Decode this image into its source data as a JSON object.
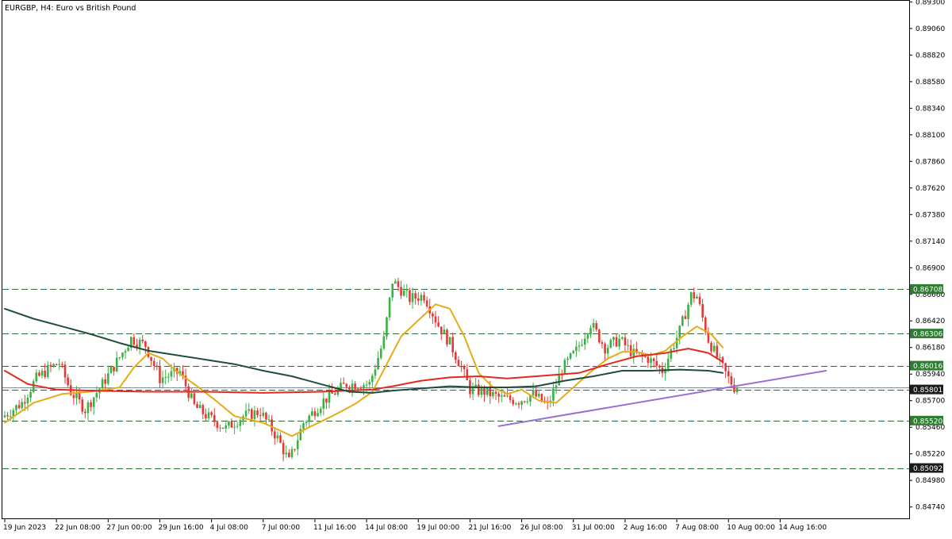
{
  "header": {
    "title": "EURGBP, H4:  Euro vs British Pound"
  },
  "colors": {
    "background": "#ffffff",
    "frame": "#000000",
    "bull": "#3cb043",
    "bear": "#e53935",
    "sma_fast": "#e6ac17",
    "sma_mid": "#e02b1f",
    "sma_slow": "#1f4f3b",
    "trendline": "#9b6fd3",
    "level_line": "#2e6b3a",
    "label_green": "#2e7d32",
    "label_black": "#1c1c1c"
  },
  "chart_data": {
    "type": "candlestick",
    "symbol": "EURGBP",
    "timeframe": "H4",
    "ylim": [
      0.8463,
      0.8931
    ],
    "y_ticks": [
      "0.89300",
      "0.89060",
      "0.88820",
      "0.88580",
      "0.88340",
      "0.88100",
      "0.87860",
      "0.87620",
      "0.87380",
      "0.87140",
      "0.86900",
      "0.86660",
      "0.86420",
      "0.86180",
      "0.85940",
      "0.85700",
      "0.85460",
      "0.85220",
      "0.84980",
      "0.84740"
    ],
    "x_ticks": [
      "19 Jun 2023",
      "22 Jun 08:00",
      "27 Jun 00:00",
      "29 Jun 16:00",
      "4 Jul 08:00",
      "7 Jul 00:00",
      "11 Jul 16:00",
      "14 Jul 08:00",
      "19 Jul 00:00",
      "21 Jul 16:00",
      "26 Jul 08:00",
      "31 Jul 00:00",
      "2 Aug 16:00",
      "7 Aug 08:00",
      "10 Aug 00:00",
      "14 Aug 16:00"
    ],
    "candles": {
      "anchors": [
        [
          0,
          0.8555
        ],
        [
          7,
          0.8568
        ],
        [
          12,
          0.859
        ],
        [
          17,
          0.86
        ],
        [
          20,
          0.8604
        ],
        [
          24,
          0.8578
        ],
        [
          29,
          0.8562
        ],
        [
          35,
          0.8585
        ],
        [
          40,
          0.8605
        ],
        [
          45,
          0.8626
        ],
        [
          50,
          0.862
        ],
        [
          55,
          0.859
        ],
        [
          62,
          0.8596
        ],
        [
          67,
          0.8565
        ],
        [
          72,
          0.8555
        ],
        [
          78,
          0.8545
        ],
        [
          84,
          0.8556
        ],
        [
          90,
          0.856
        ],
        [
          96,
          0.8536
        ],
        [
          100,
          0.8515
        ],
        [
          105,
          0.855
        ],
        [
          112,
          0.857
        ],
        [
          120,
          0.8585
        ],
        [
          128,
          0.8585
        ],
        [
          133,
          0.8625
        ],
        [
          136,
          0.8678
        ],
        [
          142,
          0.8662
        ],
        [
          147,
          0.8665
        ],
        [
          152,
          0.8638
        ],
        [
          156,
          0.8622
        ],
        [
          160,
          0.86
        ],
        [
          163,
          0.858
        ],
        [
          168,
          0.8578
        ],
        [
          174,
          0.8572
        ],
        [
          180,
          0.857
        ],
        [
          185,
          0.8576
        ],
        [
          190,
          0.8565
        ],
        [
          195,
          0.8598
        ],
        [
          200,
          0.8615
        ],
        [
          205,
          0.864
        ],
        [
          210,
          0.8618
        ],
        [
          215,
          0.8625
        ],
        [
          220,
          0.8612
        ],
        [
          225,
          0.8608
        ],
        [
          230,
          0.8597
        ],
        [
          236,
          0.8633
        ],
        [
          240,
          0.8665
        ],
        [
          242,
          0.8664
        ],
        [
          246,
          0.8625
        ],
        [
          250,
          0.8604
        ],
        [
          253,
          0.859
        ],
        [
          255,
          0.8582
        ]
      ],
      "count": 256,
      "seed": 7
    },
    "series": [
      {
        "key": "sma_fast",
        "style": "moving-average",
        "points": [
          [
            0,
            0.855
          ],
          [
            10,
            0.8568
          ],
          [
            20,
            0.8576
          ],
          [
            30,
            0.8578
          ],
          [
            40,
            0.8582
          ],
          [
            45,
            0.86
          ],
          [
            50,
            0.8613
          ],
          [
            55,
            0.8608
          ],
          [
            60,
            0.8596
          ],
          [
            67,
            0.8583
          ],
          [
            73,
            0.8571
          ],
          [
            80,
            0.8556
          ],
          [
            90,
            0.855
          ],
          [
            100,
            0.8538
          ],
          [
            106,
            0.8546
          ],
          [
            114,
            0.8556
          ],
          [
            122,
            0.8567
          ],
          [
            128,
            0.8578
          ],
          [
            133,
            0.8603
          ],
          [
            138,
            0.8628
          ],
          [
            145,
            0.8645
          ],
          [
            150,
            0.8657
          ],
          [
            155,
            0.8653
          ],
          [
            160,
            0.8628
          ],
          [
            165,
            0.8595
          ],
          [
            170,
            0.8582
          ],
          [
            175,
            0.8576
          ],
          [
            180,
            0.858
          ],
          [
            186,
            0.857
          ],
          [
            192,
            0.8568
          ],
          [
            198,
            0.8582
          ],
          [
            204,
            0.8596
          ],
          [
            210,
            0.8608
          ],
          [
            215,
            0.8614
          ],
          [
            220,
            0.8614
          ],
          [
            225,
            0.8611
          ],
          [
            230,
            0.8615
          ],
          [
            236,
            0.8628
          ],
          [
            241,
            0.8637
          ],
          [
            246,
            0.863
          ],
          [
            250,
            0.8618
          ]
        ]
      },
      {
        "key": "sma_mid",
        "style": "moving-average",
        "points": [
          [
            0,
            0.8597
          ],
          [
            8,
            0.8585
          ],
          [
            18,
            0.858
          ],
          [
            30,
            0.8579
          ],
          [
            50,
            0.8578
          ],
          [
            70,
            0.8578
          ],
          [
            90,
            0.8577
          ],
          [
            110,
            0.8578
          ],
          [
            128,
            0.858
          ],
          [
            135,
            0.8583
          ],
          [
            145,
            0.8588
          ],
          [
            155,
            0.8591
          ],
          [
            165,
            0.8592
          ],
          [
            175,
            0.859
          ],
          [
            190,
            0.8593
          ],
          [
            200,
            0.8595
          ],
          [
            210,
            0.8603
          ],
          [
            220,
            0.861
          ],
          [
            230,
            0.8613
          ],
          [
            238,
            0.8617
          ],
          [
            245,
            0.8613
          ],
          [
            250,
            0.8605
          ]
        ]
      },
      {
        "key": "sma_slow",
        "style": "moving-average",
        "points": [
          [
            0,
            0.8653
          ],
          [
            10,
            0.8644
          ],
          [
            20,
            0.8637
          ],
          [
            30,
            0.863
          ],
          [
            40,
            0.8622
          ],
          [
            50,
            0.8615
          ],
          [
            60,
            0.8611
          ],
          [
            70,
            0.8607
          ],
          [
            80,
            0.8603
          ],
          [
            90,
            0.8597
          ],
          [
            100,
            0.8592
          ],
          [
            110,
            0.8585
          ],
          [
            120,
            0.8578
          ],
          [
            128,
            0.8577
          ],
          [
            135,
            0.8579
          ],
          [
            145,
            0.8581
          ],
          [
            155,
            0.8583
          ],
          [
            165,
            0.8582
          ],
          [
            175,
            0.8582
          ],
          [
            185,
            0.8583
          ],
          [
            195,
            0.8588
          ],
          [
            205,
            0.8592
          ],
          [
            215,
            0.8597
          ],
          [
            225,
            0.8597
          ],
          [
            235,
            0.8598
          ],
          [
            245,
            0.8597
          ],
          [
            250,
            0.8595
          ]
        ]
      },
      {
        "key": "trendline",
        "style": "trendline",
        "points": [
          [
            172,
            0.8547
          ],
          [
            286,
            0.8597
          ]
        ]
      }
    ],
    "levels": [
      {
        "value": 0.86708,
        "label": "0.86708",
        "label_style": "green"
      },
      {
        "value": 0.86306,
        "label": "0.86306",
        "label_style": "green"
      },
      {
        "value": 0.86016,
        "label": "0.86016",
        "label_style": "green"
      },
      {
        "value": 0.85801,
        "label": "0.85801",
        "label_style": "black"
      },
      {
        "value": 0.8552,
        "label": "0.85520",
        "label_style": "green"
      },
      {
        "value": 0.85092,
        "label": "0.85092",
        "label_style": "black"
      }
    ],
    "current_price": {
      "value": 0.8582,
      "label": "0.85801"
    },
    "grid": false
  }
}
